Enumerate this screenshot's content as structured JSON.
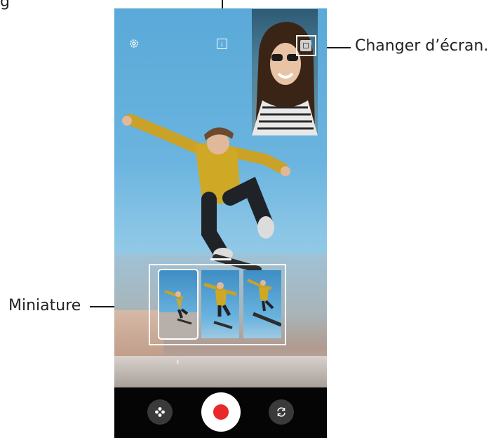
{
  "callouts": {
    "switch_screen": "Changer d’écran.",
    "thumbnail": "Miniature",
    "top_left_partial": "g"
  },
  "icons": {
    "settings": "gear-icon",
    "download": "download-icon",
    "switch_screen": "switch-screen-icon",
    "effects": "flower-icon",
    "record": "record-icon",
    "flip_camera": "flip-camera-icon",
    "back": "chevron-left-icon"
  },
  "colors": {
    "record_red": "#e8282b",
    "bottom_bar": "#050505",
    "sky": "#6ab4df"
  },
  "thumbnails": [
    {
      "state": "selected"
    },
    {
      "state": "normal"
    },
    {
      "state": "normal"
    }
  ]
}
